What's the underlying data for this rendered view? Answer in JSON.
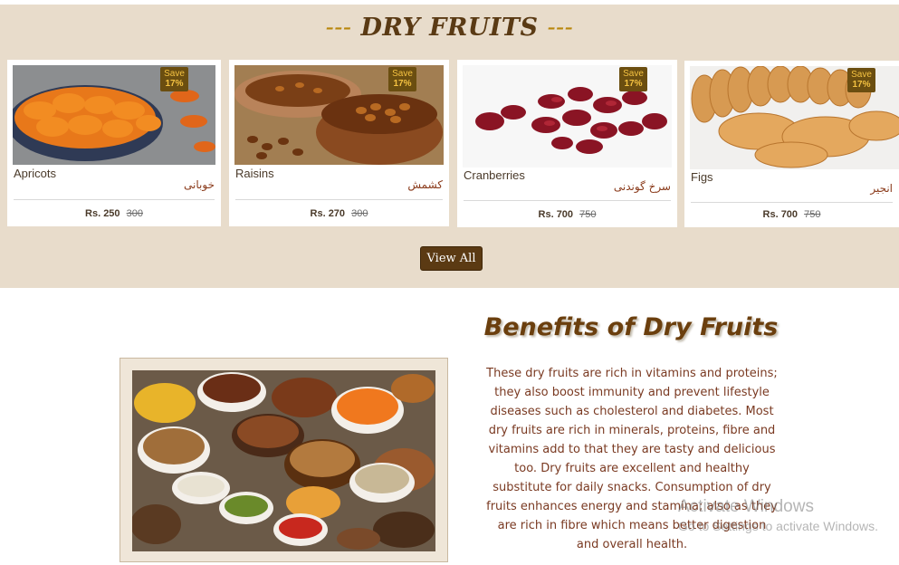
{
  "section": {
    "dashes_left": "---",
    "title": "DRY FRUITS",
    "dashes_right": "---"
  },
  "products": [
    {
      "name_en": "Apricots",
      "name_ur": "خوبانی",
      "save_label": "Save",
      "save_pct": "17%",
      "price_now": "Rs. 250",
      "price_was": "300"
    },
    {
      "name_en": "Raisins",
      "name_ur": "کشمش",
      "save_label": "Save",
      "save_pct": "17%",
      "price_now": "Rs. 270",
      "price_was": "300"
    },
    {
      "name_en": "Cranberries",
      "name_ur": "سرخ گوندنی",
      "save_label": "Save",
      "save_pct": "17%",
      "price_now": "Rs. 700",
      "price_was": "750"
    },
    {
      "name_en": "Figs",
      "name_ur": "انجیر",
      "save_label": "Save",
      "save_pct": "17%",
      "price_now": "Rs. 700",
      "price_was": "750"
    }
  ],
  "view_all_label": "View All",
  "benefits": {
    "title": "Benefits of Dry Fruits",
    "body": "These dry fruits are rich in vitamins and proteins; they also boost immunity and prevent lifestyle diseases such as cholesterol and diabetes. Most dry fruits are rich in minerals, proteins, fibre and vitamins add to that they are tasty and delicious too. Dry fruits are excellent and healthy substitute for daily snacks. Consumption of dry fruits enhances energy and stamina; also as they are rich in fibre which means better digestion and overall health."
  },
  "watermark": {
    "line1": "Activate Windows",
    "line2": "Go to Settings to activate Windows."
  },
  "colors": {
    "section_bg": "#e8dccb",
    "title_brown": "#5a3a14",
    "accent_gold": "#b8860b",
    "button_brown": "#5b3a13",
    "badge_bg": "#6b4e10",
    "badge_text": "#f4c242"
  }
}
